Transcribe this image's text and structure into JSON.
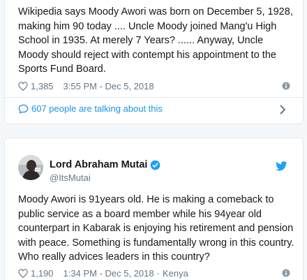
{
  "tweet1": {
    "text": "Wikipedia says Moody Awori was born on December 5, 1928, making him 90 today .... Uncle Moody joined Mang'u High School in 1935. At merely 7 Years? ...... Anyway, Uncle Moody should reject with contempt his appointment to the Sports Fund Board.",
    "likes": "1,385",
    "timestamp": "3:55 PM - Dec 5, 2018",
    "talking": "607 people are talking about this"
  },
  "tweet2": {
    "author_name": "Lord Abraham Mutai",
    "author_handle": "@ItsMutai",
    "text": "Moody Awori is 91years old. He is making a comeback to public service as a board member while his 94year old counterpart in Kabarak is enjoying his retirement and pension with peace. Something is fundamentally wrong in this country. Who really advices leaders in this country?",
    "likes": "1,190",
    "timestamp": "1:34 PM - Dec 5, 2018",
    "location": "Kenya"
  },
  "colors": {
    "link": "#1b95e0",
    "muted": "#657786",
    "border": "#e1e8ed",
    "twitter_blue": "#1da1f2"
  },
  "icons": [
    "heart-icon",
    "info-icon",
    "comment-bubble-icon",
    "chevron-right-icon",
    "verified-badge-icon",
    "twitter-bird-icon"
  ]
}
